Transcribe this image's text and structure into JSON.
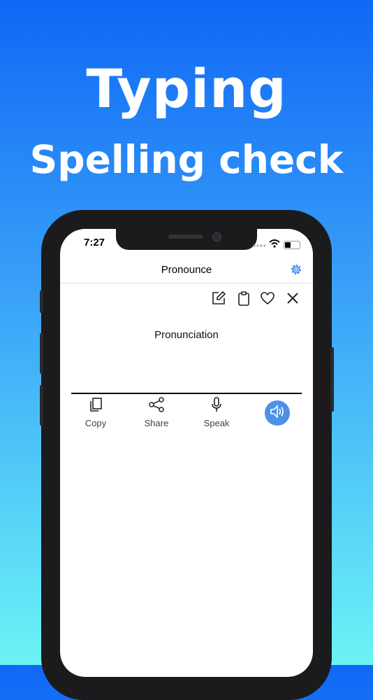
{
  "promo": {
    "title": "Typing",
    "subtitle": "Spelling check"
  },
  "status_bar": {
    "time": "7:27"
  },
  "nav": {
    "title": "Pronounce",
    "settings_icon": "gear-icon"
  },
  "toolbar": [
    "edit-icon",
    "clipboard-icon",
    "heart-icon",
    "close-icon"
  ],
  "content": {
    "text": "Pronunciation"
  },
  "actions": {
    "copy": "Copy",
    "share": "Share",
    "speak": "Speak"
  },
  "colors": {
    "accent": "#4e8fe8",
    "gradient_top": "#1068f5",
    "gradient_bottom": "#6bf4f6"
  }
}
